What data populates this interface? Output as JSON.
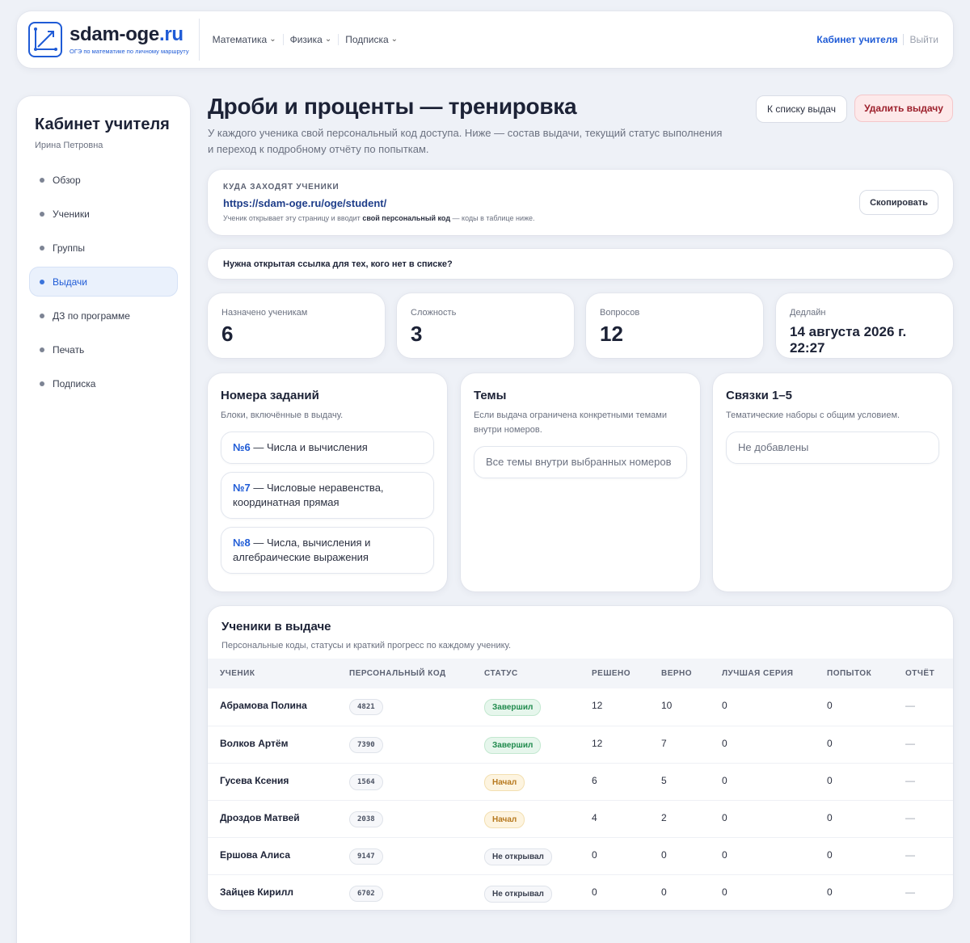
{
  "header": {
    "logo_title_main": "sdam-oge",
    "logo_title_accent": ".ru",
    "logo_subtitle": "ОГЭ по математике по личному маршруту",
    "nav": [
      {
        "label": "Математика"
      },
      {
        "label": "Физика"
      },
      {
        "label": "Подписка"
      }
    ],
    "teacher_link": "Кабинет учителя",
    "logout": "Выйти"
  },
  "sidebar": {
    "title": "Кабинет учителя",
    "user": "Ирина Петровна",
    "items": [
      {
        "label": "Обзор"
      },
      {
        "label": "Ученики"
      },
      {
        "label": "Группы"
      },
      {
        "label": "Выдачи"
      },
      {
        "label": "ДЗ по программе"
      },
      {
        "label": "Печать"
      },
      {
        "label": "Подписка"
      }
    ]
  },
  "page": {
    "title": "Дроби и проценты — тренировка",
    "description": "У каждого ученика свой персональный код доступа. Ниже — состав выдачи, текущий статус выполнения и переход к подробному отчёту по попыткам.",
    "back_button": "К списку выдач",
    "delete_button": "Удалить выдачу"
  },
  "access": {
    "label": "КУДА ЗАХОДЯТ УЧЕНИКИ",
    "url": "https://sdam-oge.ru/oge/student/",
    "note_before": "Ученик открывает эту страницу и вводит ",
    "note_bold": "свой персональный код",
    "note_after": " — коды в таблице ниже.",
    "copy_button": "Скопировать"
  },
  "open_link_question": "Нужна открытая ссылка для тех, кого нет в списке?",
  "stats": [
    {
      "label": "Назначено ученикам",
      "value": "6"
    },
    {
      "label": "Сложность",
      "value": "3"
    },
    {
      "label": "Вопросов",
      "value": "12"
    },
    {
      "label": "Дедлайн",
      "value": "14 августа 2026 г. 22:27"
    }
  ],
  "tasks_block": {
    "title": "Номера заданий",
    "subtitle": "Блоки, включённые в выдачу.",
    "items": [
      {
        "num": "№6",
        "text": " — Числа и вычисления"
      },
      {
        "num": "№7",
        "text": " — Числовые неравенства, координатная прямая"
      },
      {
        "num": "№8",
        "text": " — Числа, вычисления и алгебраические выражения"
      }
    ]
  },
  "topics_block": {
    "title": "Темы",
    "subtitle": "Если выдача ограничена конкретными темами внутри номеров.",
    "value": "Все темы внутри выбранных номеров"
  },
  "bundles_block": {
    "title": "Связки 1–5",
    "subtitle": "Тематические наборы с общим условием.",
    "value": "Не добавлены"
  },
  "students": {
    "title": "Ученики в выдаче",
    "subtitle": "Персональные коды, статусы и краткий прогресс по каждому ученику.",
    "columns": [
      "УЧЕНИК",
      "ПЕРСОНАЛЬНЫЙ КОД",
      "СТАТУС",
      "РЕШЕНО",
      "ВЕРНО",
      "ЛУЧШАЯ СЕРИЯ",
      "ПОПЫТОК",
      "ОТЧЁТ"
    ],
    "rows": [
      {
        "name": "Абрамова Полина",
        "code": "4821",
        "status": "Завершил",
        "status_kind": "done",
        "solved": "12",
        "correct": "10",
        "streak": "0",
        "attempts": "0",
        "report": "—"
      },
      {
        "name": "Волков Артём",
        "code": "7390",
        "status": "Завершил",
        "status_kind": "done",
        "solved": "12",
        "correct": "7",
        "streak": "0",
        "attempts": "0",
        "report": "—"
      },
      {
        "name": "Гусева Ксения",
        "code": "1564",
        "status": "Начал",
        "status_kind": "started",
        "solved": "6",
        "correct": "5",
        "streak": "0",
        "attempts": "0",
        "report": "—"
      },
      {
        "name": "Дроздов Матвей",
        "code": "2038",
        "status": "Начал",
        "status_kind": "started",
        "solved": "4",
        "correct": "2",
        "streak": "0",
        "attempts": "0",
        "report": "—"
      },
      {
        "name": "Ершова Алиса",
        "code": "9147",
        "status": "Не открывал",
        "status_kind": "none",
        "solved": "0",
        "correct": "0",
        "streak": "0",
        "attempts": "0",
        "report": "—"
      },
      {
        "name": "Зайцев Кирилл",
        "code": "6702",
        "status": "Не открывал",
        "status_kind": "none",
        "solved": "0",
        "correct": "0",
        "streak": "0",
        "attempts": "0",
        "report": "—"
      }
    ]
  },
  "colors": {
    "accent": "#1f5bd6",
    "done": "#1f8a4c",
    "started": "#b7791f",
    "danger": "#9c1f2b"
  }
}
